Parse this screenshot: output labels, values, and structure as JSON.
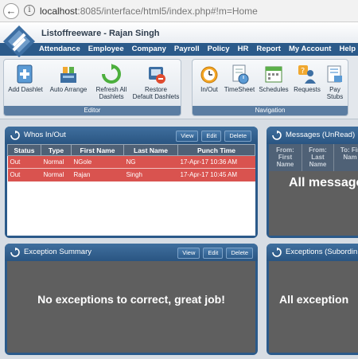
{
  "browser": {
    "url_host": "localhost",
    "url_rest": ":8085/interface/html5/index.php#!m=Home"
  },
  "app": {
    "title": "Listoffreeware - Rajan Singh"
  },
  "menu": [
    "Attendance",
    "Employee",
    "Company",
    "Payroll",
    "Policy",
    "HR",
    "Report",
    "My Account",
    "Help",
    "D"
  ],
  "ribbon": {
    "editor": {
      "label": "Editor",
      "buttons": [
        {
          "line1": "Add Dashlet",
          "line2": ""
        },
        {
          "line1": "Auto Arrange",
          "line2": ""
        },
        {
          "line1": "Refresh All",
          "line2": "Dashlets"
        },
        {
          "line1": "Restore",
          "line2": "Default Dashlets"
        }
      ]
    },
    "navigation": {
      "label": "Navigation",
      "buttons": [
        {
          "line1": "In/Out",
          "line2": ""
        },
        {
          "line1": "TimeSheet",
          "line2": ""
        },
        {
          "line1": "Schedules",
          "line2": ""
        },
        {
          "line1": "Requests",
          "line2": ""
        },
        {
          "line1": "Pay",
          "line2": "Stubs"
        }
      ]
    }
  },
  "dashlet_buttons": {
    "view": "View",
    "edit": "Edit",
    "delete": "Delete"
  },
  "whos_in_out": {
    "title": "Whos In/Out",
    "columns": [
      "Status",
      "Type",
      "First Name",
      "Last Name",
      "Punch Time"
    ],
    "rows": [
      [
        "Out",
        "Normal",
        "NGole",
        "NG",
        "17-Apr-17 10:36 AM"
      ],
      [
        "Out",
        "Normal",
        "Rajan",
        "Singh",
        "17-Apr-17 10:45 AM"
      ]
    ]
  },
  "messages": {
    "title": "Messages (UnRead)",
    "columns": [
      {
        "line1": "From:",
        "line2": "First",
        "line3": "Name"
      },
      {
        "line1": "From:",
        "line2": "Last",
        "line3": "Name"
      },
      {
        "line1": "To: Fir",
        "line2": "Nam",
        "line3": ""
      }
    ],
    "empty_text": "All message"
  },
  "exception_summary": {
    "title": "Exception Summary",
    "empty_text": "No exceptions to correct, great job!"
  },
  "exceptions_sub": {
    "title": "Exceptions (Subordin",
    "empty_text": "All exception"
  },
  "colors": {
    "header_blue": "#2b5a8a",
    "row_red": "#d9534f",
    "panel_gray": "#5f5f5f"
  }
}
